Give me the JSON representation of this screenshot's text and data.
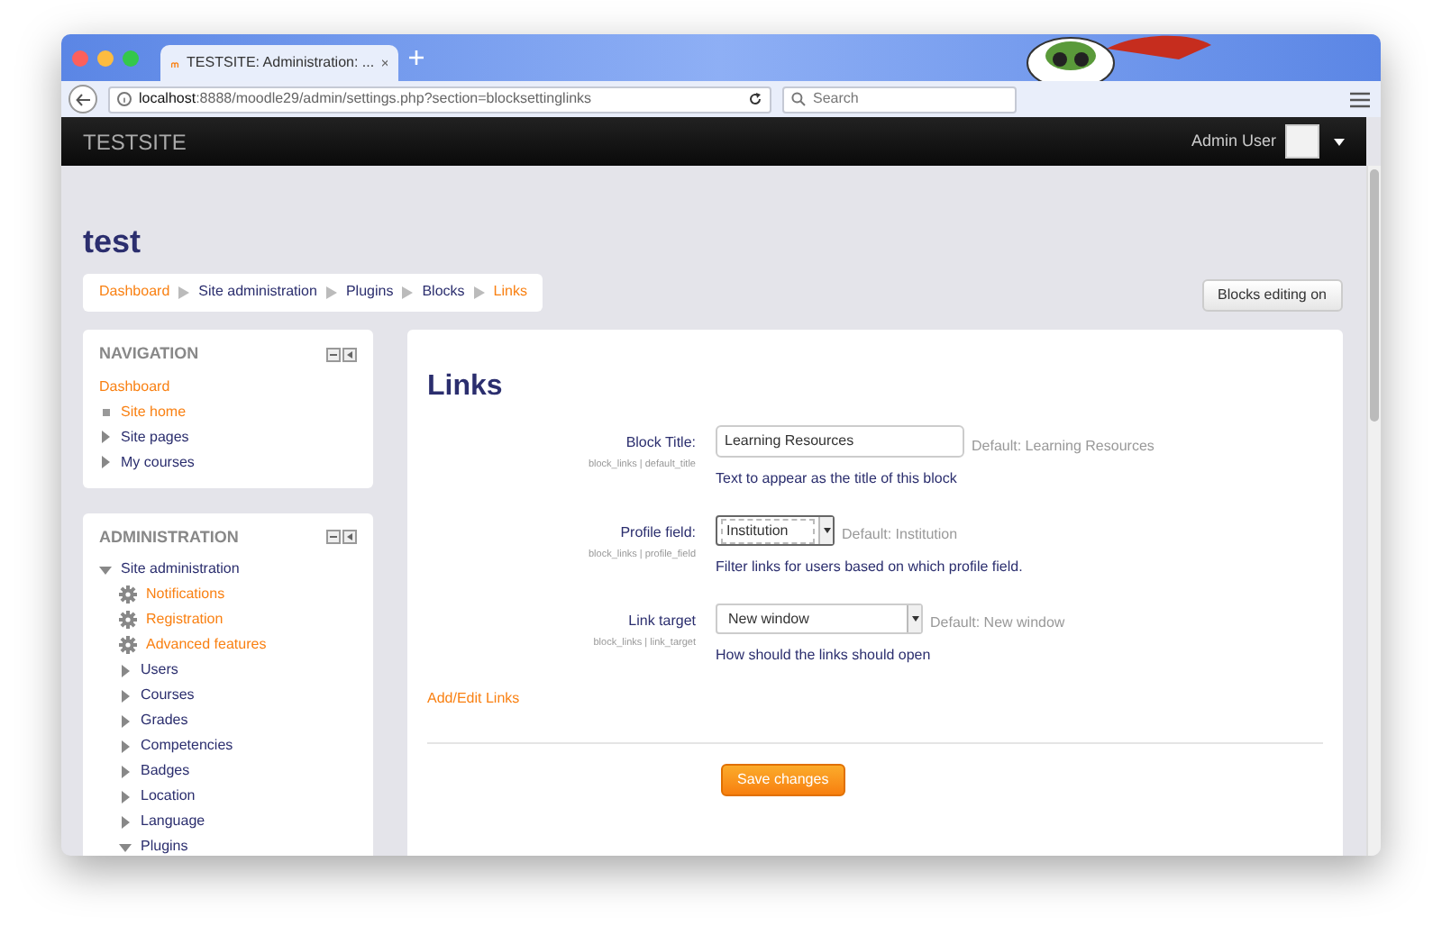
{
  "browser": {
    "tab_title": "TESTSITE: Administration: ...",
    "url_host": "localhost",
    "url_path": ":8888/moodle29/admin/settings.php?section=blocksettinglinks",
    "search_placeholder": "Search"
  },
  "navbar": {
    "brand": "TESTSITE",
    "user": "Admin User"
  },
  "page_title": "test",
  "breadcrumb": [
    {
      "label": "Dashboard",
      "kind": "link"
    },
    {
      "label": "Site administration",
      "kind": "text"
    },
    {
      "label": "Plugins",
      "kind": "text"
    },
    {
      "label": "Blocks",
      "kind": "text"
    },
    {
      "label": "Links",
      "kind": "link"
    }
  ],
  "editing_button": "Blocks editing on",
  "navigation": {
    "title": "NAVIGATION",
    "items": [
      {
        "label": "Dashboard",
        "kind": "link"
      },
      {
        "label": "Site home",
        "kind": "current"
      },
      {
        "label": "Site pages",
        "kind": "branch",
        "expanded": false
      },
      {
        "label": "My courses",
        "kind": "branch",
        "expanded": false
      }
    ]
  },
  "administration": {
    "title": "ADMINISTRATION",
    "tree": [
      {
        "label": "Site administration",
        "kind": "branch",
        "expanded": true,
        "children": [
          {
            "label": "Notifications",
            "kind": "setting"
          },
          {
            "label": "Registration",
            "kind": "setting"
          },
          {
            "label": "Advanced features",
            "kind": "setting"
          },
          {
            "label": "Users",
            "kind": "branch",
            "expanded": false
          },
          {
            "label": "Courses",
            "kind": "branch",
            "expanded": false
          },
          {
            "label": "Grades",
            "kind": "branch",
            "expanded": false
          },
          {
            "label": "Competencies",
            "kind": "branch",
            "expanded": false
          },
          {
            "label": "Badges",
            "kind": "branch",
            "expanded": false
          },
          {
            "label": "Location",
            "kind": "branch",
            "expanded": false
          },
          {
            "label": "Language",
            "kind": "branch",
            "expanded": false
          },
          {
            "label": "Plugins",
            "kind": "branch",
            "expanded": true
          }
        ]
      }
    ]
  },
  "main": {
    "heading": "Links",
    "settings": [
      {
        "label": "Block Title:",
        "key": "block_links | default_title",
        "kind": "text",
        "value": "Learning Resources",
        "default": "Default: Learning Resources",
        "description": "Text to appear as the title of this block"
      },
      {
        "label": "Profile field:",
        "key": "block_links | profile_field",
        "kind": "select-small",
        "value": "Institution",
        "default": "Default: Institution",
        "description": "Filter links for users based on which profile field."
      },
      {
        "label": "Link target",
        "key": "block_links | link_target",
        "kind": "select",
        "value": "New window",
        "default": "Default: New window",
        "description": "How should the links should open"
      }
    ],
    "add_link": "Add/Edit Links",
    "save_button": "Save changes"
  }
}
